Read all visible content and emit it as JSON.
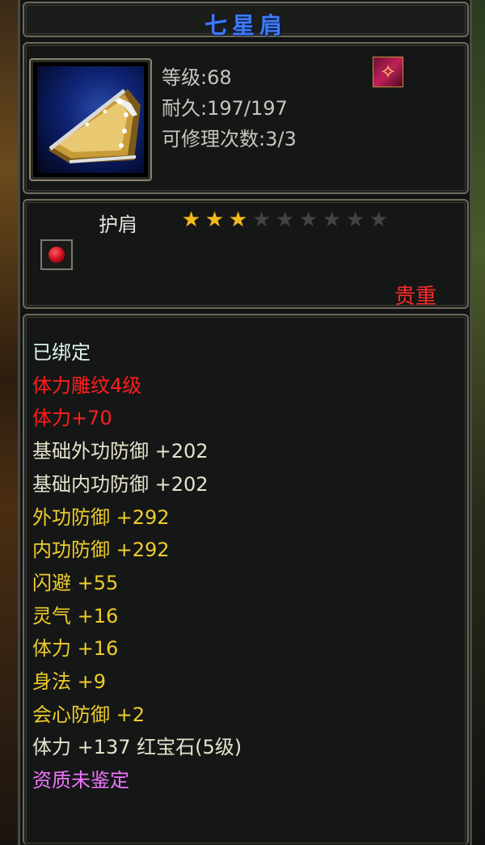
{
  "item": {
    "name": "七星肩",
    "stats": {
      "level": "等级:68",
      "durability": "耐久:197/197",
      "repairs": "可修理次数:3/3"
    },
    "badge_glyph": "✧",
    "type": "护肩",
    "stars_total": 9,
    "stars_filled": 3,
    "rarity": "贵重",
    "attributes": [
      {
        "text": "已绑定",
        "color": "white"
      },
      {
        "text": "体力雕纹4级",
        "color": "red"
      },
      {
        "text": "体力+70",
        "color": "red"
      },
      {
        "text": "基础外功防御 +202",
        "color": "light"
      },
      {
        "text": "基础内功防御 +202",
        "color": "light"
      },
      {
        "text": "外功防御 +292",
        "color": "yellow"
      },
      {
        "text": "内功防御 +292",
        "color": "yellow"
      },
      {
        "text": "闪避 +55",
        "color": "yellow"
      },
      {
        "text": "灵气 +16",
        "color": "yellow"
      },
      {
        "text": "体力 +16",
        "color": "yellow"
      },
      {
        "text": "身法 +9",
        "color": "yellow"
      },
      {
        "text": "会心防御 +2",
        "color": "yellow"
      },
      {
        "text": "体力 +137 红宝石(5级)",
        "color": "light"
      },
      {
        "text": "资质未鉴定",
        "color": "purple"
      }
    ]
  },
  "colors": {
    "title": "#3f7bf3",
    "rarity": "#ff2a2a",
    "star_on": "#f0b91c",
    "star_off": "#43443f"
  }
}
